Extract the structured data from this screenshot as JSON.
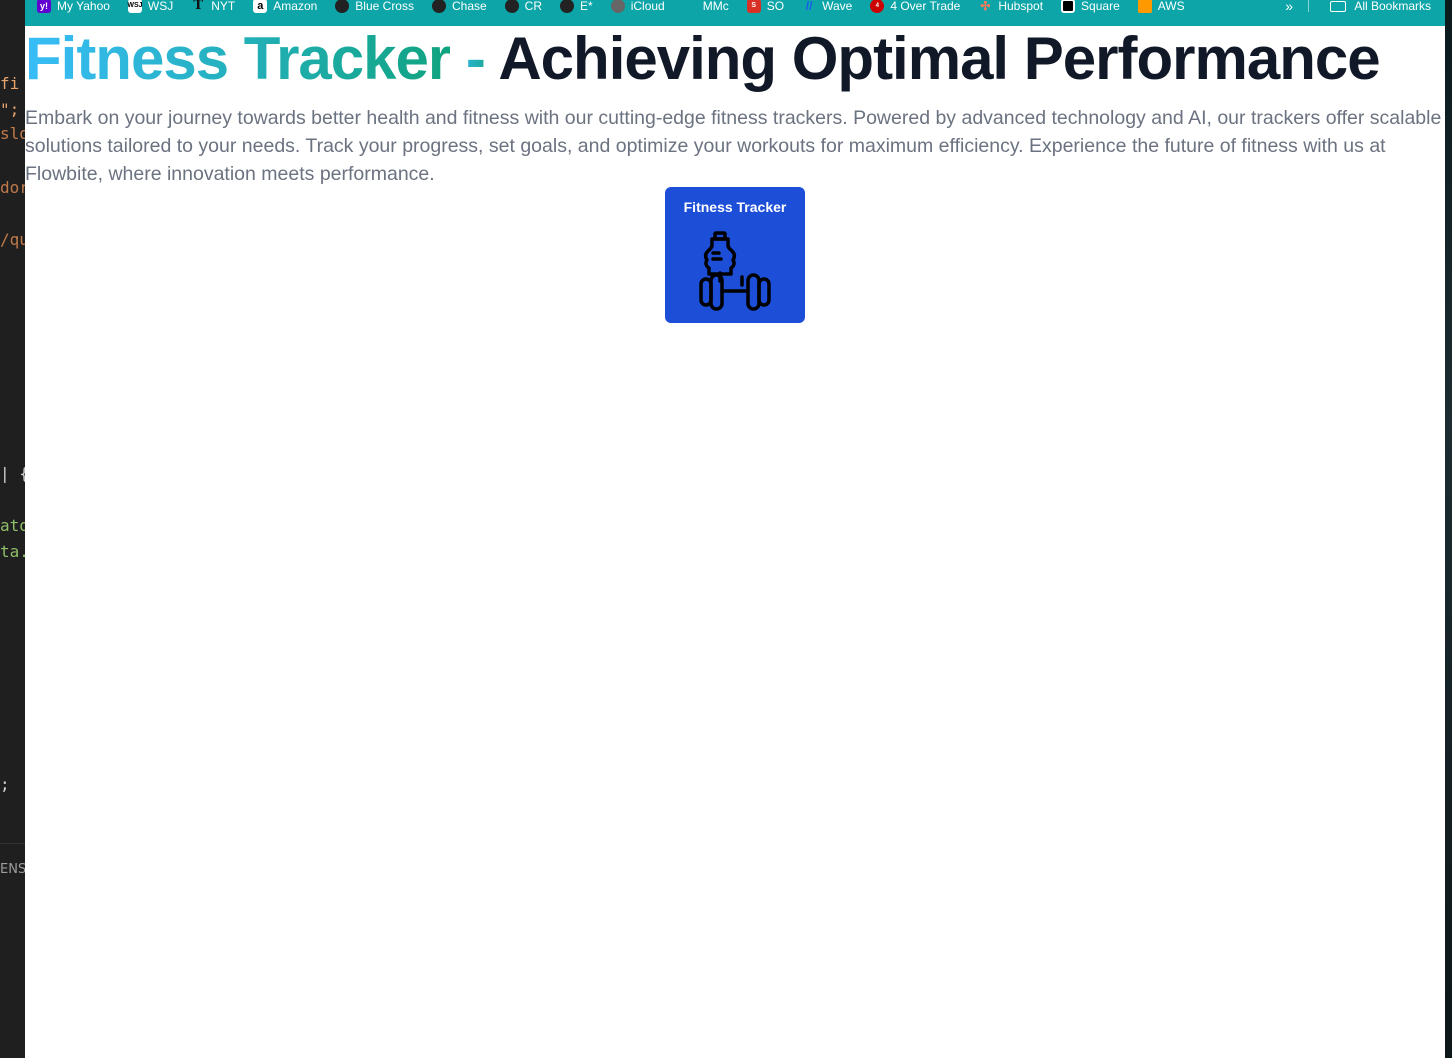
{
  "editor": {
    "lines": [
      "fi",
      "\";",
      "slo",
      "dor",
      "/qu",
      "| {",
      "ato",
      "ta.",
      ";",
      "ENS"
    ]
  },
  "bookmarks": [
    {
      "label": "My Yahoo",
      "icon": "yahoo-icon",
      "color": "#6001d2"
    },
    {
      "label": "WSJ",
      "icon": "wsj-icon",
      "color": "#ffffff"
    },
    {
      "label": "NYT",
      "icon": "nyt-icon",
      "color": "#111111"
    },
    {
      "label": "Amazon",
      "icon": "amazon-icon",
      "color": "#ffffff"
    },
    {
      "label": "Blue Cross",
      "icon": "globe-icon",
      "color": "#222222"
    },
    {
      "label": "Chase",
      "icon": "globe-icon",
      "color": "#222222"
    },
    {
      "label": "CR",
      "icon": "globe-icon",
      "color": "#222222"
    },
    {
      "label": "E*",
      "icon": "globe-icon",
      "color": "#222222"
    },
    {
      "label": "iCloud",
      "icon": "apple-icon",
      "color": "#555555"
    },
    {
      "label": "MMc",
      "icon": "blank-icon",
      "color": "#0ea5a8"
    },
    {
      "label": "SO",
      "icon": "so-icon",
      "color": "#d93025"
    },
    {
      "label": "Wave",
      "icon": "wave-icon",
      "color": "#1a5cf0"
    },
    {
      "label": "4 Over Trade",
      "icon": "4over-icon",
      "color": "#cc0000"
    },
    {
      "label": "Hubspot",
      "icon": "hubspot-icon",
      "color": "#ff7a59"
    },
    {
      "label": "Square",
      "icon": "square-icon",
      "color": "#000000"
    },
    {
      "label": "AWS",
      "icon": "aws-icon",
      "color": "#ff9900"
    }
  ],
  "bookmarks_more": "»",
  "all_bookmarks": "All Bookmarks",
  "hero": {
    "title_highlight": "Fitness Tracker",
    "title_dash": " - ",
    "title_rest": "Achieving Optimal Performance",
    "description": "Embark on your journey towards better health and fitness with our cutting-edge fitness trackers. Powered by advanced technology and AI, our trackers offer scalable solutions tailored to your needs. Track your progress, set goals, and optimize your workouts for maximum efficiency. Experience the future of fitness with us at Flowbite, where innovation meets performance."
  },
  "tile": {
    "label": "Fitness Tracker",
    "icon": "water-bottle-dumbbell-icon",
    "color": "#1d4ed8"
  },
  "colors": {
    "bookmarks_bar": "#0ea5a8",
    "headline_gradient_start": "#38bdf8",
    "headline_gradient_end": "#10a37f",
    "headline_text": "#111827",
    "body_text": "#6b7280"
  }
}
